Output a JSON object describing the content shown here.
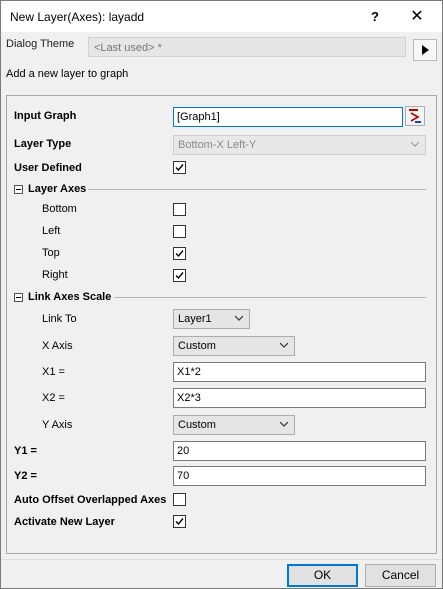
{
  "window": {
    "title": "New Layer(Axes): layadd",
    "help_label": "?",
    "close_label": "✕"
  },
  "theme": {
    "label": "Dialog Theme",
    "value": "<Last used> *"
  },
  "description": "Add a new layer to graph",
  "form": {
    "input_graph": {
      "label": "Input Graph",
      "value": "[Graph1]"
    },
    "layer_type": {
      "label": "Layer Type",
      "value": "Bottom-X Left-Y"
    },
    "user_defined": {
      "label": "User Defined",
      "checked": true
    },
    "layer_axes": {
      "label": "Layer Axes",
      "bottom": {
        "label": "Bottom",
        "checked": false
      },
      "left": {
        "label": "Left",
        "checked": false
      },
      "top": {
        "label": "Top",
        "checked": true
      },
      "right": {
        "label": "Right",
        "checked": true
      }
    },
    "link_axes_scale": {
      "label": "Link Axes Scale",
      "link_to": {
        "label": "Link To",
        "value": "Layer1"
      },
      "x_axis": {
        "label": "X Axis",
        "value": "Custom"
      },
      "x1": {
        "label": "X1 =",
        "value": "X1*2"
      },
      "x2": {
        "label": "X2 =",
        "value": "X2*3"
      },
      "y_axis": {
        "label": "Y Axis",
        "value": "Custom"
      }
    },
    "y1": {
      "label": "Y1 =",
      "value": "20"
    },
    "y2": {
      "label": "Y2 =",
      "value": "70"
    },
    "auto_offset": {
      "label": "Auto Offset Overlapped Axes",
      "checked": false
    },
    "activate_new_layer": {
      "label": "Activate New Layer",
      "checked": true
    }
  },
  "buttons": {
    "ok": "OK",
    "cancel": "Cancel"
  }
}
